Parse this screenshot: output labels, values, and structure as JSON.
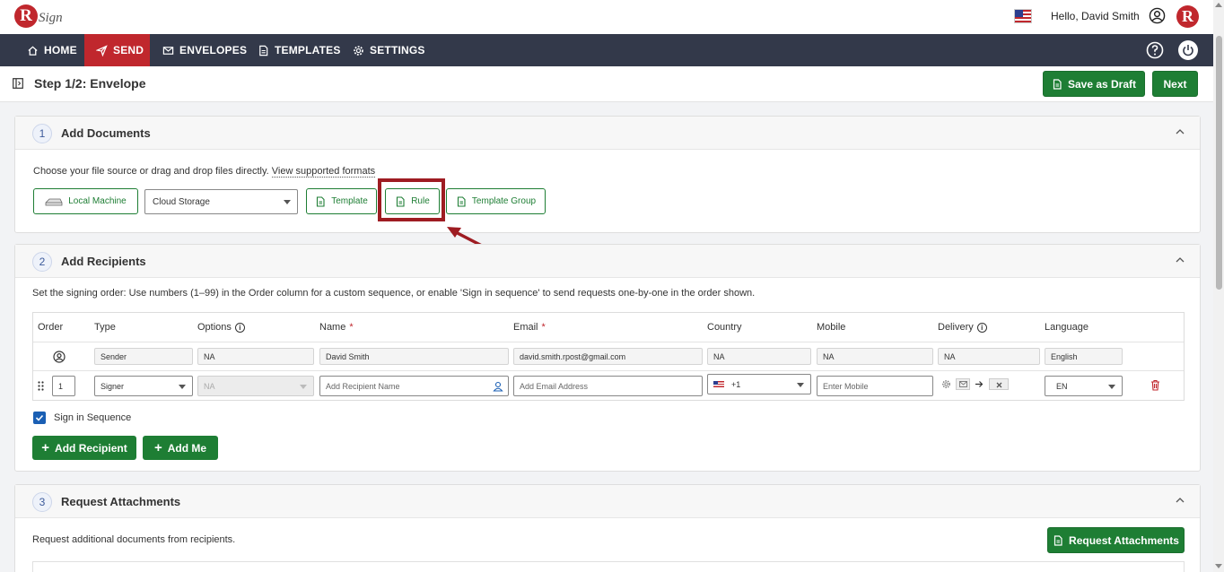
{
  "header": {
    "logo_letter": "R",
    "logo_text": "Sign",
    "greeting": "Hello, David Smith",
    "avatar_letter": "R"
  },
  "nav": {
    "items": [
      {
        "label": "HOME",
        "icon": "home-icon"
      },
      {
        "label": "SEND",
        "icon": "send-icon",
        "active": true
      },
      {
        "label": "ENVELOPES",
        "icon": "envelope-icon"
      },
      {
        "label": "TEMPLATES",
        "icon": "document-icon"
      },
      {
        "label": "SETTINGS",
        "icon": "gear-icon"
      }
    ]
  },
  "step": {
    "title": "Step 1/2: Envelope",
    "save_draft": "Save as Draft",
    "next": "Next"
  },
  "add_documents": {
    "number": "1",
    "title": "Add Documents",
    "instruction": "Choose your file source or drag and drop files directly.",
    "formats_link": "View supported formats",
    "local_machine": "Local Machine",
    "cloud_storage": "Cloud Storage",
    "template": "Template",
    "rule": "Rule",
    "template_group": "Template Group"
  },
  "add_recipients": {
    "number": "2",
    "title": "Add Recipients",
    "instruction": "Set the signing order: Use numbers (1–99) in the Order column for a custom sequence, or enable 'Sign in sequence' to send requests one-by-one in the order shown.",
    "columns": {
      "order": "Order",
      "type": "Type",
      "options": "Options",
      "name": "Name",
      "email": "Email",
      "country": "Country",
      "mobile": "Mobile",
      "delivery": "Delivery",
      "language": "Language",
      "required_mark": "*"
    },
    "sender": {
      "type": "Sender",
      "options": "NA",
      "name": "David Smith",
      "email": "david.smith.rpost@gmail.com",
      "country": "NA",
      "mobile": "NA",
      "delivery": "NA",
      "language": "English"
    },
    "signer": {
      "order": "1",
      "type": "Signer",
      "options": "NA",
      "name_placeholder": "Add Recipient Name",
      "email_placeholder": "Add Email Address",
      "country_code": "+1",
      "mobile_placeholder": "Enter Mobile",
      "language": "EN"
    },
    "sign_in_sequence": "Sign in Sequence",
    "add_recipient": "Add Recipient",
    "add_me": "Add Me"
  },
  "request_attachments": {
    "number": "3",
    "title": "Request Attachments",
    "instruction": "Request additional documents from recipients.",
    "button": "Request Attachments"
  },
  "colors": {
    "brand_red": "#c0272d",
    "nav_bg": "#33394a",
    "primary_green": "#1e7e34",
    "highlight": "#9e1c22"
  }
}
